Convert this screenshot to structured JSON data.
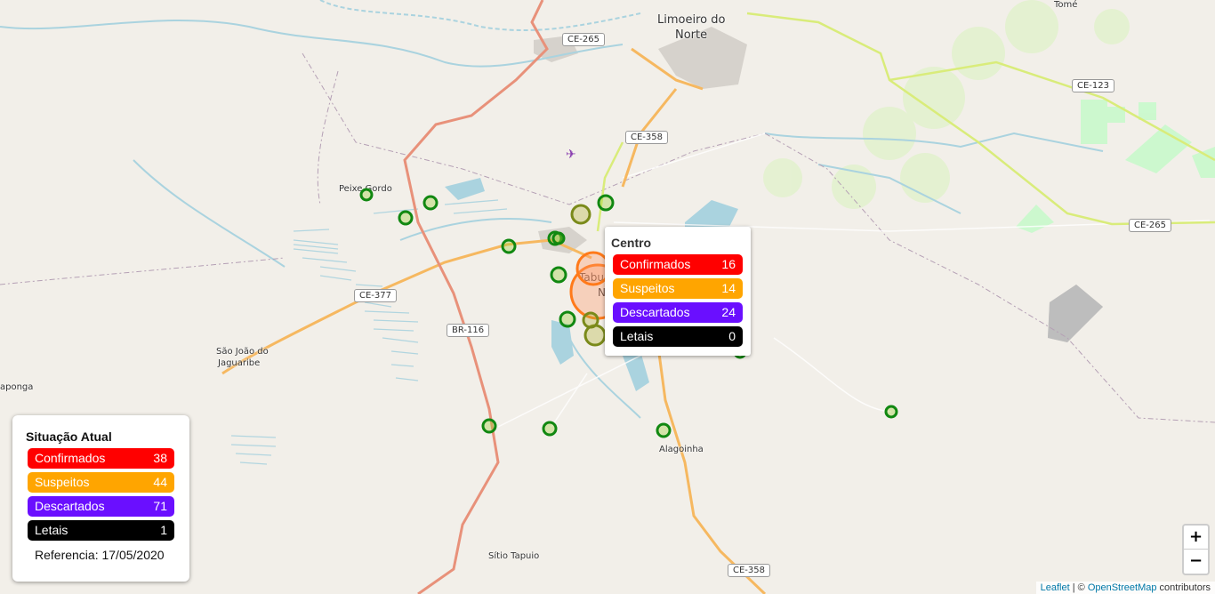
{
  "map": {
    "places": {
      "limoeiro_line1": "Limoeiro do",
      "limoeiro_line2": "Norte",
      "tome": "Tomé",
      "peixe_gordo": "Peixe Gordo",
      "sao_joao_line1": "São João do",
      "sao_joao_line2": "Jaguaribe",
      "aponga": "aponga",
      "alagoinha": "Alagoinha",
      "sitio_tapuio": "Sítio Tapuio",
      "tabuleiro_partial": "Tabu",
      "norte_partial": "N",
      "tabuleiro_suffix": "iro"
    },
    "roads": {
      "ce265_north": "CE-265",
      "ce358_north": "CE-358",
      "ce123": "CE-123",
      "ce265_east": "CE-265",
      "ce377": "CE-377",
      "br116": "BR-116",
      "ce358_south": "CE-358"
    },
    "colors": {
      "background": "#f2efe9",
      "water": "#aad3df",
      "primary_road": "#e8917a",
      "secondary_road": "#f6c06a",
      "tertiary_road": "#d9ec7a",
      "park": "#c8facc",
      "urban": "#cccccc"
    }
  },
  "popup": {
    "title": "Centro",
    "rows": [
      {
        "label": "Confirmados",
        "value": "16",
        "color": "#ff0000"
      },
      {
        "label": "Suspeitos",
        "value": "14",
        "color": "#ffa500"
      },
      {
        "label": "Descartados",
        "value": "24",
        "color": "#6a0fff"
      },
      {
        "label": "Letais",
        "value": "0",
        "color": "#000000"
      }
    ]
  },
  "legend": {
    "title": "Situação Atual",
    "rows": [
      {
        "label": "Confirmados",
        "value": "38",
        "color": "#ff0000"
      },
      {
        "label": "Suspeitos",
        "value": "44",
        "color": "#ffa500"
      },
      {
        "label": "Descartados",
        "value": "71",
        "color": "#6a0fff"
      },
      {
        "label": "Letais",
        "value": "1",
        "color": "#000000"
      }
    ],
    "reference": "Referencia: 17/05/2020"
  },
  "zoom": {
    "in_label": "+",
    "out_label": "−"
  },
  "attribution": {
    "leaflet": "Leaflet",
    "sep": " | © ",
    "osm": "OpenStreetMap",
    "suffix": " contributors"
  }
}
